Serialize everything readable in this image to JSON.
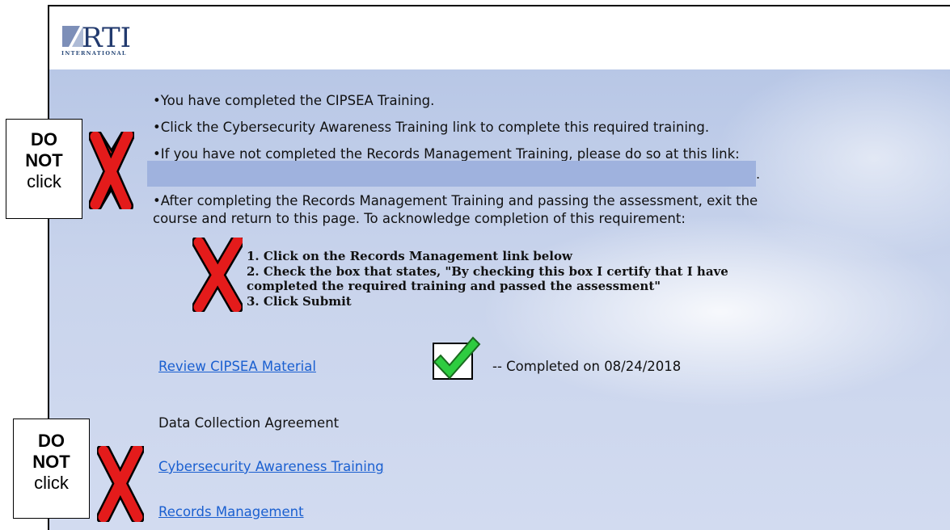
{
  "logo": {
    "text": "RTI",
    "subtext": "INTERNATIONAL"
  },
  "bullets": [
    "•You have completed the CIPSEA Training.",
    "•Click the Cybersecurity Awareness Training link to complete this required training.",
    "•If you have not completed the Records Management Training, please do so at this link:",
    "•After completing the Records Management Training and passing the assessment, exit the",
    "course and return to this page. To acknowledge completion of this requirement:"
  ],
  "redaction_trailing": ".",
  "steps": [
    "1. Click on the Records Management link below",
    "2. Check the box that states, \"By checking this box I certify that I have",
    "completed the required training and passed the assessment\"",
    "3. Click Submit"
  ],
  "links": {
    "review_cipsea": "Review CIPSEA Material",
    "cybersecurity": "Cybersecurity Awareness Training",
    "records": "Records Management"
  },
  "completed_text": "-- Completed on 08/24/2018",
  "data_collection_label": "Data Collection Agreement",
  "notes": [
    {
      "line1": "DO",
      "line2": "NOT",
      "line3": "click"
    },
    {
      "line1": "DO",
      "line2": "NOT",
      "line3": "click"
    }
  ],
  "colors": {
    "link": "#1a5fd0",
    "x_mark": "#e41b1b",
    "check": "#2ecc40",
    "redaction": "#9fb2de"
  }
}
